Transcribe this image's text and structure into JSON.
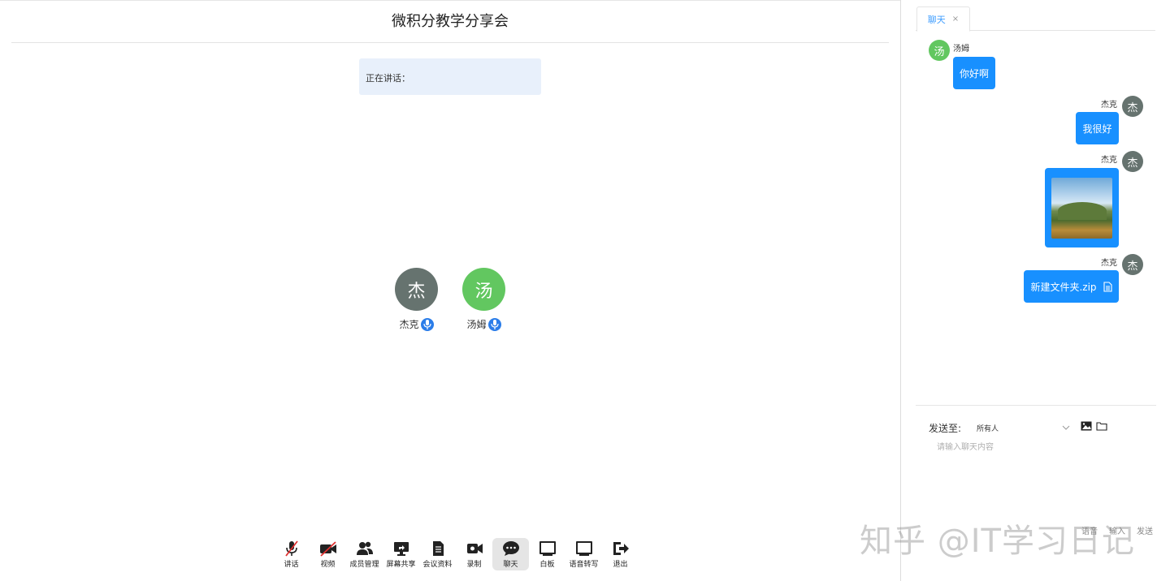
{
  "meeting": {
    "title": "微积分教学分享会",
    "speaking_label": "正在讲话：",
    "participants": [
      {
        "avatar_char": "杰",
        "name": "杰克",
        "color": "#66736f"
      },
      {
        "avatar_char": "汤",
        "name": "汤姆",
        "color": "#62c760"
      }
    ]
  },
  "toolbar": {
    "items": [
      {
        "label": "讲话",
        "icon": "mic-off-icon"
      },
      {
        "label": "视频",
        "icon": "video-off-icon"
      },
      {
        "label": "成员管理",
        "icon": "users-icon"
      },
      {
        "label": "屏幕共享",
        "icon": "screen-share-icon"
      },
      {
        "label": "会议资料",
        "icon": "document-icon"
      },
      {
        "label": "录制",
        "icon": "record-icon"
      },
      {
        "label": "聊天",
        "icon": "chat-icon",
        "active": true
      },
      {
        "label": "白板",
        "icon": "whiteboard-icon"
      },
      {
        "label": "语音转写",
        "icon": "transcribe-icon"
      },
      {
        "label": "退出",
        "icon": "exit-icon"
      }
    ]
  },
  "chat": {
    "tab_label": "聊天",
    "tab_close": "×",
    "messages": [
      {
        "sender": "汤姆",
        "avatar_char": "汤",
        "side": "left",
        "type": "text",
        "text": "你好啊"
      },
      {
        "sender": "杰克",
        "avatar_char": "杰",
        "side": "right",
        "type": "text",
        "text": "我很好"
      },
      {
        "sender": "杰克",
        "avatar_char": "杰",
        "side": "right",
        "type": "image"
      },
      {
        "sender": "杰克",
        "avatar_char": "杰",
        "side": "right",
        "type": "file",
        "text": "新建文件夹.zip"
      }
    ],
    "send_to_label": "发送至:",
    "send_to_value": "所有人",
    "input_placeholder": "请输入聊天内容",
    "bottom_buttons": [
      "语音",
      "输入",
      "发送"
    ]
  },
  "colors": {
    "accent": "#1890ff",
    "avatar_jack": "#66736f",
    "avatar_tom": "#62c760"
  },
  "watermark": "知乎 @IT学习日记"
}
